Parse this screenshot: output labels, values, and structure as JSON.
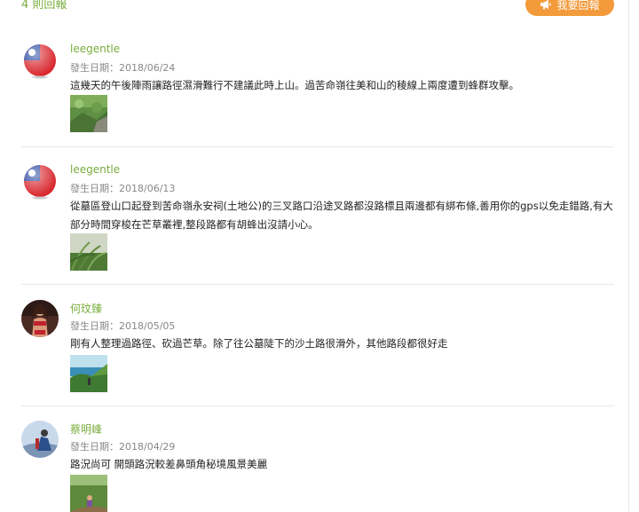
{
  "header": {
    "report_count": "4 則回報",
    "reply_button_label": "我要回報",
    "reply_icon": "megaphone-icon"
  },
  "reports": [
    {
      "user": "leegentle",
      "avatar": "taiwan-flag-avatar",
      "date": "發生日期：2018/06/24",
      "text": "這幾天的午後陣雨讓路徑濕滑難行不建議此時上山。過苦命嶺往美和山的稜線上兩度遭到蜂群攻擊。",
      "photo": "grass-photo"
    },
    {
      "user": "leegentle",
      "avatar": "taiwan-flag-avatar",
      "date": "發生日期：2018/06/13",
      "text": "從墓區登山口起登到苦命嶺永安祠(土地公)的三叉路口沿途叉路都沒路標且兩邊都有綁布條,善用你的gps以免走錯路,有大部分時間穿梭在芒草叢裡,整段路都有胡蜂出沒請小心。",
      "photo": "silvergrass-photo"
    },
    {
      "user": "何玟臻",
      "avatar": "person-avatar",
      "date": "發生日期：2018/05/05",
      "text": "剛有人整理過路徑、砍過芒草。除了往公墓陡下的沙土路很滑外，其他路段都很好走",
      "photo": "coast-view-photo"
    },
    {
      "user": "蔡明峰",
      "avatar": "hiker-avatar",
      "date": "發生日期：2018/04/29",
      "text": "路況尚可 開頭路況較差鼻頭角秘境風景美麗",
      "photo": "hiker-trail-photo"
    }
  ]
}
